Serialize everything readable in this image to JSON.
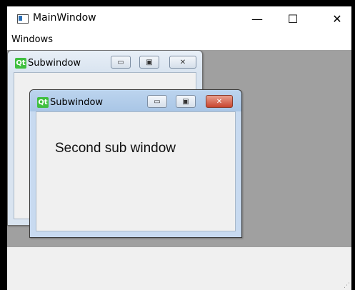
{
  "window": {
    "title": "MainWindow"
  },
  "menu": {
    "items": [
      {
        "label": "Windows"
      }
    ]
  },
  "title_buttons": {
    "minimize": "—",
    "maximize": "☐",
    "close": "✕"
  },
  "subwindows": [
    {
      "title": "Subwindow",
      "icon_text": "Qt",
      "content": ""
    },
    {
      "title": "Subwindow",
      "icon_text": "Qt",
      "content": "Second sub window"
    }
  ],
  "sub_buttons": {
    "minimize": "▭",
    "restore": "▣",
    "close": "✕"
  }
}
